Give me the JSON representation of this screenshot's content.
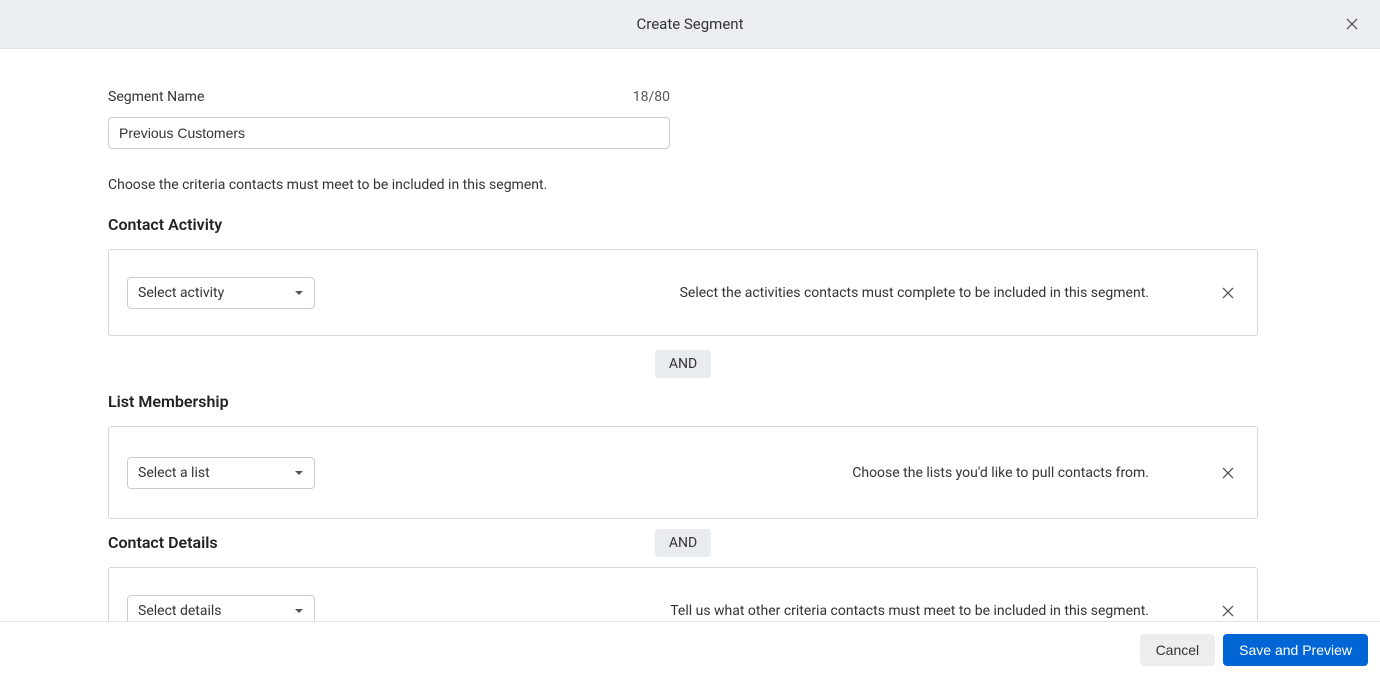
{
  "header": {
    "title": "Create Segment"
  },
  "segment_name": {
    "label": "Segment Name",
    "char_count": "18/80",
    "value": "Previous Customers"
  },
  "criteria_intro": "Choose the criteria contacts must meet to be included in this segment.",
  "activity": {
    "title": "Contact Activity",
    "select_label": "Select activity",
    "hint": "Select the activities contacts must complete to be included in this segment."
  },
  "connector": {
    "label": "AND"
  },
  "list_membership": {
    "title": "List Membership",
    "select_label": "Select a list",
    "hint": "Choose the lists you'd like to pull contacts from."
  },
  "contact_details": {
    "title": "Contact Details",
    "select_label": "Select details",
    "hint": "Tell us what other criteria contacts must meet to be included in this segment."
  },
  "footer": {
    "cancel": "Cancel",
    "save": "Save and Preview"
  }
}
